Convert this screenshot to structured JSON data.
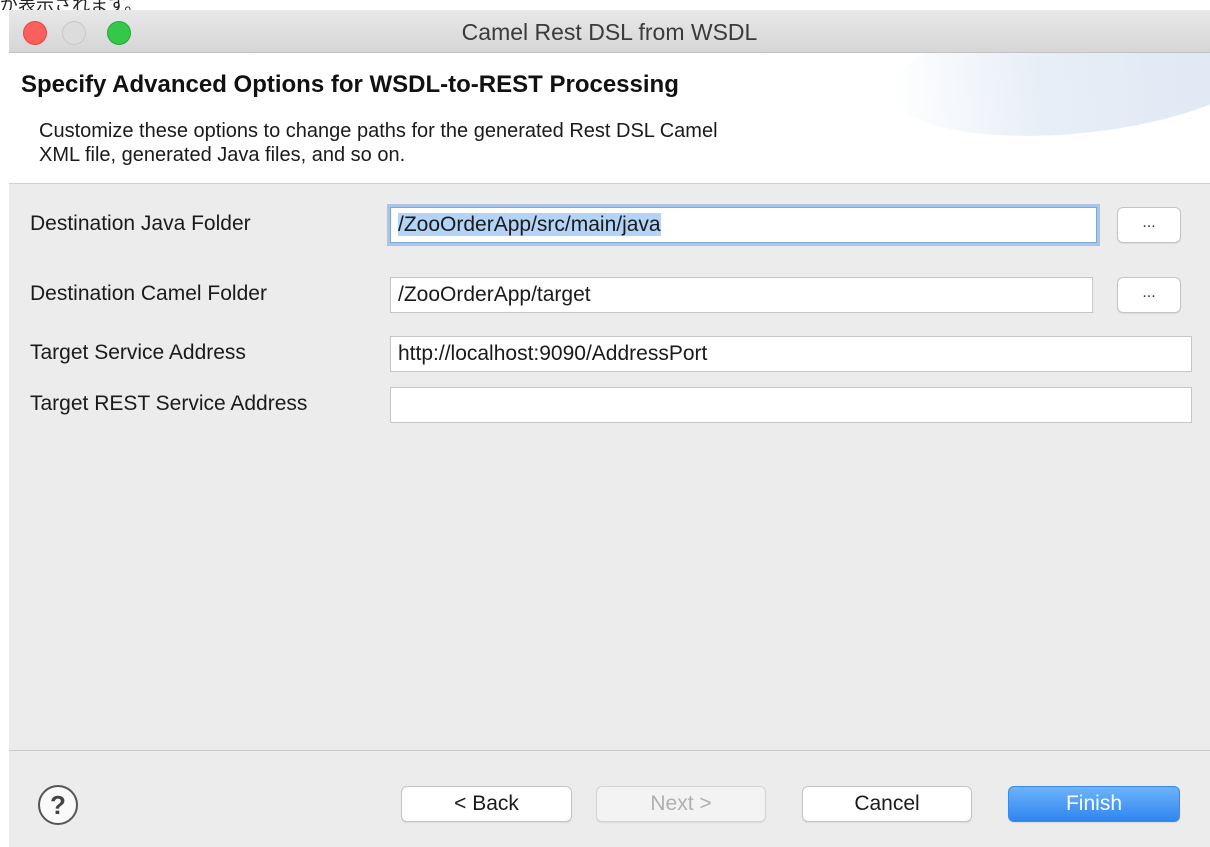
{
  "page_fragment": "が表示されます。",
  "window": {
    "title": "Camel Rest DSL from WSDL"
  },
  "banner": {
    "title": "Specify Advanced Options for WSDL-to-REST Processing",
    "description_line1": "Customize these options to change paths for the generated Rest DSL Camel",
    "description_line2": "XML file, generated Java files, and so on."
  },
  "form": {
    "java_folder": {
      "label": "Destination Java Folder",
      "value": "/ZooOrderApp/src/main/java",
      "browse_label": "..."
    },
    "camel_folder": {
      "label": "Destination Camel Folder",
      "value": "/ZooOrderApp/target",
      "browse_label": "..."
    },
    "target_service": {
      "label": "Target Service Address",
      "value": "http://localhost:9090/AddressPort"
    },
    "target_rest_service": {
      "label": "Target REST Service Address",
      "value": ""
    }
  },
  "footer": {
    "help_glyph": "?",
    "back_label": "< Back",
    "next_label": "Next >",
    "cancel_label": "Cancel",
    "finish_label": "Finish"
  },
  "colors": {
    "accent": "#2f86f0",
    "selection": "#b3d3f7",
    "focus_ring": "#a9c6ea"
  }
}
